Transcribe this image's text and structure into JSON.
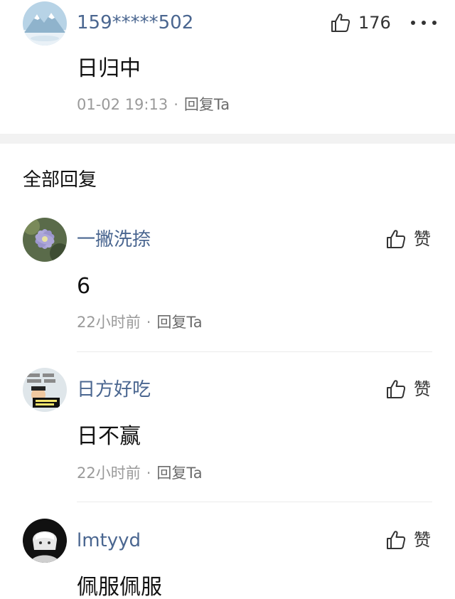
{
  "top_comment": {
    "username": "159*****502",
    "like_count": "176",
    "content": "日归中",
    "time": "01-02 19:13",
    "separator": "·",
    "reply_label": "回复Ta",
    "more_icon": "more-dots-icon"
  },
  "section": {
    "title": "全部回复"
  },
  "replies": [
    {
      "username": "一撇洗捺",
      "content": "6",
      "time": "22小时前",
      "separator": "·",
      "reply_label": "回复Ta",
      "like_label": "赞"
    },
    {
      "username": "日方好吃",
      "content": "日不赢",
      "time": "22小时前",
      "separator": "·",
      "reply_label": "回复Ta",
      "like_label": "赞"
    },
    {
      "username": "lmtyyd",
      "content": "佩服佩服",
      "like_label": "赞"
    }
  ],
  "colors": {
    "username": "#4a6690",
    "meta": "#9a9a9a",
    "band": "#f2f2f2"
  }
}
